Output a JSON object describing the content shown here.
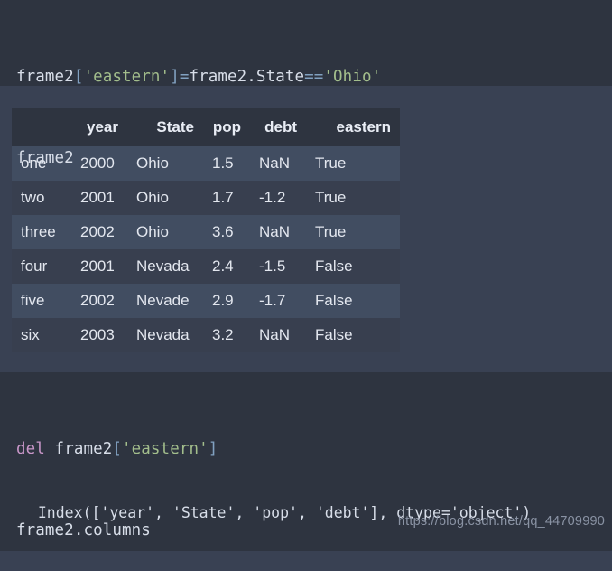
{
  "theme": {
    "page_bg": "#394153",
    "code_bg": "#2e3440",
    "row_odd_bg": "#414d61",
    "row_even_bg": "#383f4f",
    "text": "#d8dee9",
    "string_color": "#a3be8c",
    "operator_color": "#81a1c1",
    "keyword_color": "#c896c8"
  },
  "code_cell_1": {
    "line1": {
      "t1": "frame2",
      "t2": "[",
      "t3": "'eastern'",
      "t4": "]",
      "t5": "=",
      "t6": "frame2.State",
      "t7": "==",
      "t8": "'Ohio'"
    },
    "line2": {
      "t1": "frame2"
    }
  },
  "dataframe": {
    "columns": [
      "",
      "year",
      "State",
      "pop",
      "debt",
      "eastern"
    ],
    "index": [
      "one",
      "two",
      "three",
      "four",
      "five",
      "six"
    ],
    "rows": [
      {
        "index": "one",
        "year": "2000",
        "State": "Ohio",
        "pop": "1.5",
        "debt": "NaN",
        "eastern": "True"
      },
      {
        "index": "two",
        "year": "2001",
        "State": "Ohio",
        "pop": "1.7",
        "debt": "-1.2",
        "eastern": "True"
      },
      {
        "index": "three",
        "year": "2002",
        "State": "Ohio",
        "pop": "3.6",
        "debt": "NaN",
        "eastern": "True"
      },
      {
        "index": "four",
        "year": "2001",
        "State": "Nevada",
        "pop": "2.4",
        "debt": "-1.5",
        "eastern": "False"
      },
      {
        "index": "five",
        "year": "2002",
        "State": "Nevade",
        "pop": "2.9",
        "debt": "-1.7",
        "eastern": "False"
      },
      {
        "index": "six",
        "year": "2003",
        "State": "Nevada",
        "pop": "3.2",
        "debt": "NaN",
        "eastern": "False"
      }
    ]
  },
  "code_cell_2": {
    "line1": {
      "t1": "del",
      "t2": " frame2",
      "t3": "[",
      "t4": "'eastern'",
      "t5": "]"
    },
    "line2": {
      "t1": "frame2.columns"
    }
  },
  "output_cell": {
    "text": "Index(['year', 'State', 'pop', 'debt'], dtype='object')"
  },
  "watermark": {
    "text": "https://blog.csdn.net/qq_44709990"
  }
}
